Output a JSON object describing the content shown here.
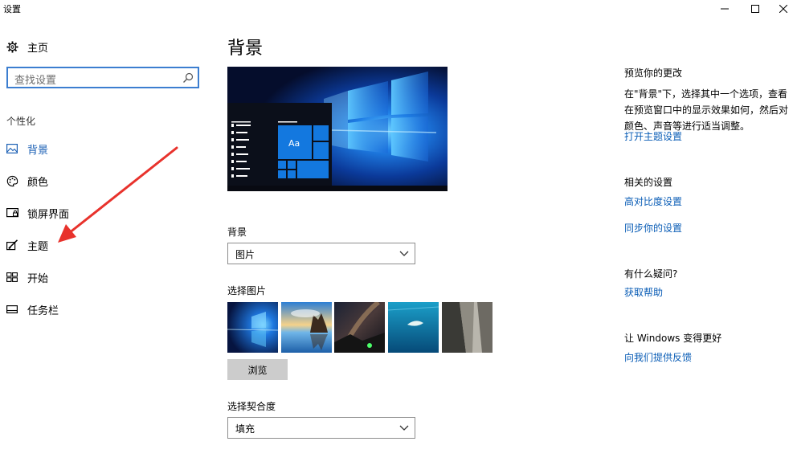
{
  "window": {
    "title": "设置",
    "controls": [
      "minimize-icon",
      "maximize-icon",
      "close-icon"
    ]
  },
  "sidebar": {
    "home_label": "主页",
    "search_placeholder": "查找设置",
    "section_title": "个性化",
    "items": [
      {
        "label": "背景",
        "icon": "picture-icon",
        "active": true
      },
      {
        "label": "颜色",
        "icon": "palette-icon",
        "active": false
      },
      {
        "label": "锁屏界面",
        "icon": "lock-screen-icon",
        "active": false
      },
      {
        "label": "主题",
        "icon": "theme-brush-icon",
        "active": false
      },
      {
        "label": "开始",
        "icon": "start-grid-icon",
        "active": false
      },
      {
        "label": "任务栏",
        "icon": "taskbar-icon",
        "active": false
      }
    ]
  },
  "main": {
    "title": "背景",
    "preview_tile_text": "Aa",
    "background_label": "背景",
    "background_value": "图片",
    "choose_picture_label": "选择图片",
    "browse_label": "浏览",
    "fit_label": "选择契合度",
    "fit_value": "填充"
  },
  "right": {
    "preview_title": "预览你的更改",
    "preview_desc": "在\"背景\"下，选择其中一个选项，查看在预览窗口中的显示效果如何，然后对颜色、声音等进行适当调整。",
    "theme_settings_link": "打开主题设置",
    "related_title": "相关的设置",
    "contrast_link": "高对比度设置",
    "sync_link": "同步你的设置",
    "question_title": "有什么疑问?",
    "help_link": "获取帮助",
    "improve_title": "让 Windows 变得更好",
    "feedback_link": "向我们提供反馈"
  },
  "colors": {
    "accent": "#0078d7",
    "link": "#0a5db6",
    "annotation_arrow": "#e8322c"
  }
}
